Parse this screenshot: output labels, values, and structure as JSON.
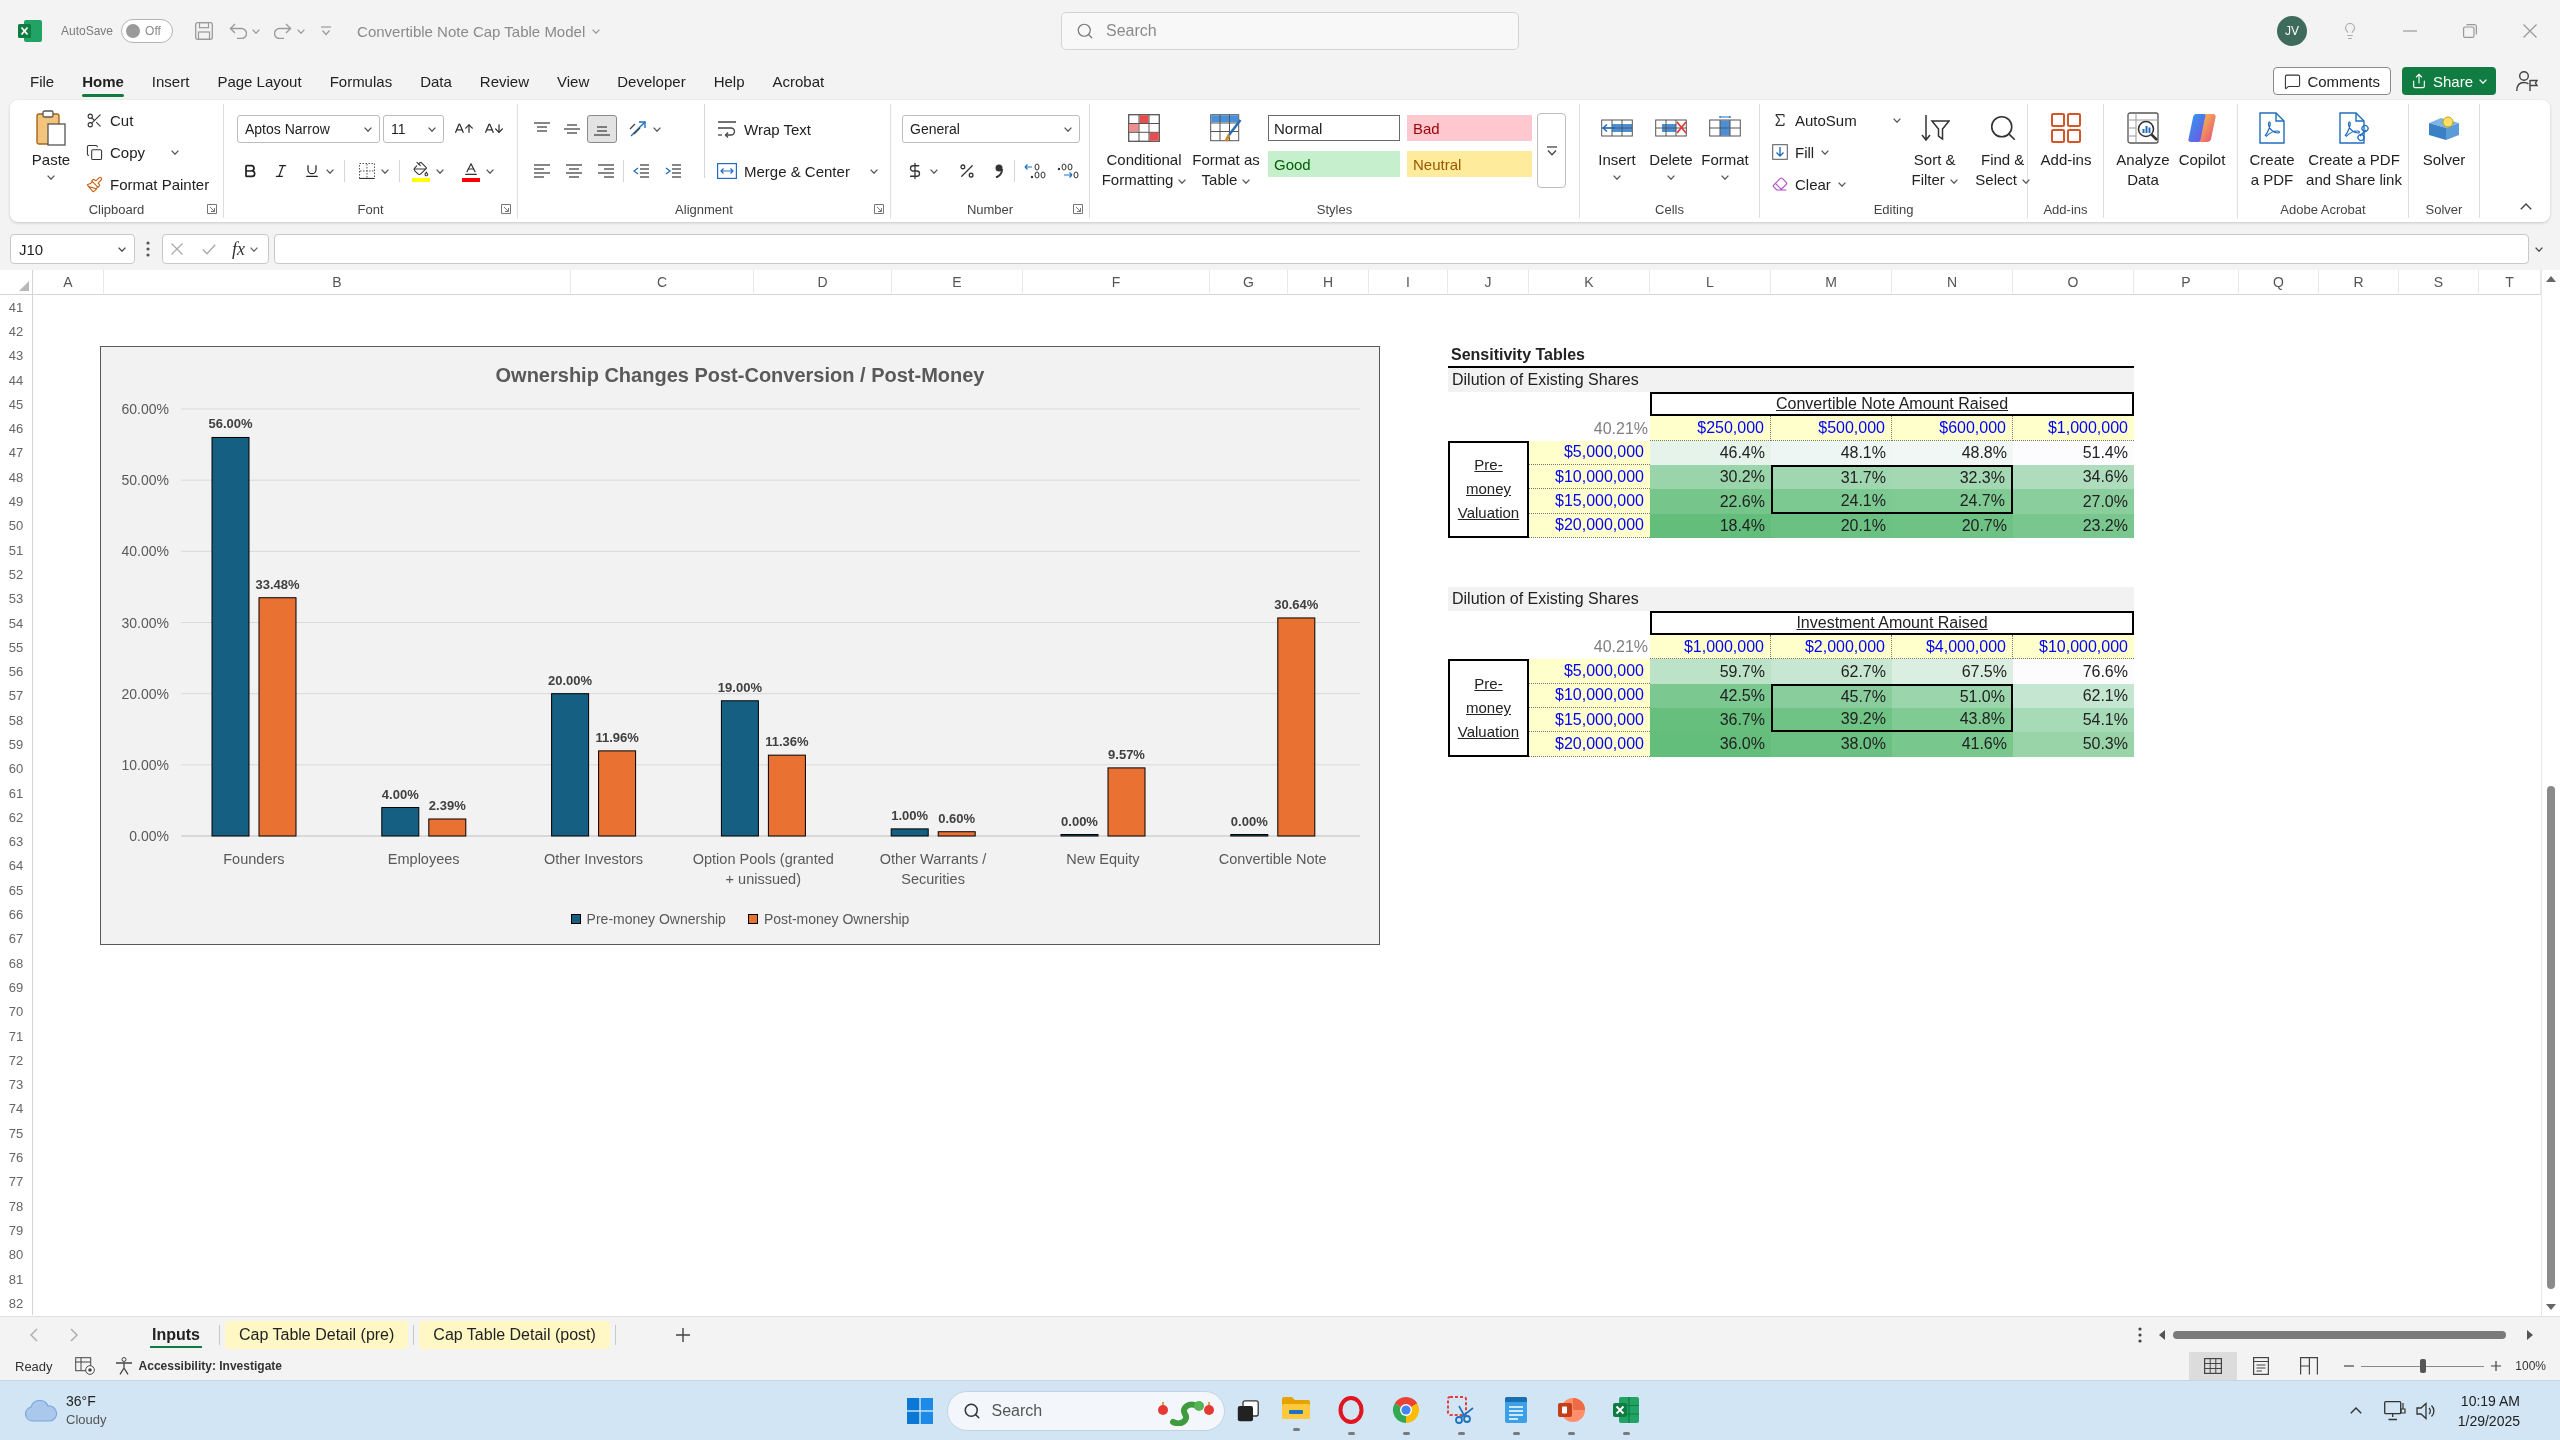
{
  "title_bar": {
    "autosave": {
      "label": "AutoSave",
      "toggle": "Off",
      "on": false
    },
    "document_title": "Convertible Note Cap Table Model",
    "search": {
      "placeholder": "Search"
    },
    "avatar": "JV"
  },
  "menu_tabs": [
    {
      "label": "File",
      "selected": false
    },
    {
      "label": "Home",
      "selected": true
    },
    {
      "label": "Insert",
      "selected": false
    },
    {
      "label": "Page Layout",
      "selected": false
    },
    {
      "label": "Formulas",
      "selected": false
    },
    {
      "label": "Data",
      "selected": false
    },
    {
      "label": "Review",
      "selected": false
    },
    {
      "label": "View",
      "selected": false
    },
    {
      "label": "Developer",
      "selected": false
    },
    {
      "label": "Help",
      "selected": false
    },
    {
      "label": "Acrobat",
      "selected": false
    }
  ],
  "header_actions": {
    "comments": "Comments",
    "share": "Share"
  },
  "ribbon": [
    {
      "kind": "clipboard",
      "label": "Clipboard",
      "launcher": true,
      "paste": "Paste",
      "commands": [
        "Cut",
        "Copy",
        "Format Painter"
      ]
    },
    {
      "kind": "font",
      "label": "Font",
      "launcher": true,
      "font_name": "Aptos Narrow",
      "font_size": "11"
    },
    {
      "kind": "alignment",
      "label": "Alignment",
      "launcher": true,
      "vertical_alignment": [
        {
          "selected": false
        },
        {
          "selected": false
        },
        {
          "selected": true
        }
      ],
      "wrap_text": "Wrap Text",
      "merge": "Merge & Center"
    },
    {
      "kind": "number",
      "label": "Number",
      "launcher": true,
      "format": "General"
    },
    {
      "kind": "styles",
      "label": "Styles",
      "commands": [
        "Conditional Formatting",
        "Format as Table"
      ],
      "cell_styles": [
        {
          "label": "Normal",
          "color": "#ffffff",
          "selected": true
        },
        {
          "label": "Bad",
          "color": "#ffc7ce",
          "selected": false
        },
        {
          "label": "Good",
          "color": "#c6efce",
          "selected": false
        },
        {
          "label": "Neutral",
          "color": "#ffeb9c",
          "selected": false
        }
      ]
    },
    {
      "kind": "cells",
      "label": "Cells",
      "commands": [
        "Insert",
        "Delete",
        "Format"
      ]
    },
    {
      "kind": "editing",
      "label": "Editing",
      "commands": [
        "AutoSum",
        "Fill",
        "Clear"
      ],
      "large_commands": [
        "Sort & Filter",
        "Find & Select"
      ]
    },
    {
      "kind": "addins",
      "label": "Add-ins",
      "commands": [
        "Add-ins"
      ]
    },
    {
      "kind": "analysis",
      "commands": [
        "Analyze Data",
        "Copilot"
      ]
    },
    {
      "kind": "acrobat",
      "label": "Adobe Acrobat",
      "commands": [
        "Create a PDF",
        "Create a PDF and Share link"
      ]
    },
    {
      "kind": "solver",
      "label": "Solver",
      "commands": [
        "Solver"
      ]
    }
  ],
  "formula_bar": {
    "name_box": "J10",
    "function_label": "fx"
  },
  "sheet": {
    "columns": [
      "A",
      "B",
      "C",
      "D",
      "E",
      "F",
      "G",
      "H",
      "I",
      "J",
      "K",
      "L",
      "M",
      "N",
      "O",
      "P",
      "Q",
      "R",
      "S",
      "T"
    ],
    "rows": [
      "41",
      "42",
      "43",
      "44",
      "45",
      "46",
      "47",
      "48",
      "49",
      "50",
      "51",
      "52",
      "53",
      "54",
      "55",
      "56",
      "57",
      "58",
      "59",
      "60",
      "61",
      "62",
      "63",
      "64",
      "65",
      "66",
      "67",
      "68",
      "69",
      "70",
      "71",
      "72",
      "73",
      "74",
      "75",
      "76",
      "77",
      "78",
      "79",
      "80",
      "81",
      "82"
    ]
  },
  "chart": {
    "chart_data": {
      "type": "bar",
      "title": "Ownership Changes Post-Conversion / Post-Money",
      "categories": [
        "Founders",
        "Employees",
        "Other Investors",
        "Option Pools (granted + unissued)",
        "Other Warrants / Securities",
        "New Equity",
        "Convertible Note"
      ],
      "series": [
        {
          "name": "Pre-money Ownership",
          "color": "#156082",
          "values": [
            56,
            4,
            20,
            19,
            1,
            0,
            0
          ],
          "value_labels": [
            "56.00%",
            "4.00%",
            "20.00%",
            "19.00%",
            "1.00%",
            "0.00%",
            "0.00%"
          ]
        },
        {
          "name": "Post-money Ownership",
          "color": "#e97132",
          "values": [
            33.48,
            2.39,
            11.96,
            11.36,
            0.6,
            9.57,
            30.64
          ],
          "value_labels": [
            "33.48%",
            "2.39%",
            "11.96%",
            "11.36%",
            "0.60%",
            "9.57%",
            "30.64%"
          ]
        }
      ],
      "ylim": [
        0,
        60
      ],
      "yticks": [
        {
          "value": 0,
          "label": "0.00%"
        },
        {
          "value": 10,
          "label": "10.00%"
        },
        {
          "value": 20,
          "label": "20.00%"
        },
        {
          "value": 30,
          "label": "30.00%"
        },
        {
          "value": 40,
          "label": "40.00%"
        },
        {
          "value": 50,
          "label": "50.00%"
        },
        {
          "value": 60,
          "label": "60.00%"
        }
      ],
      "grid": true,
      "legend": "bottom"
    }
  },
  "sensitivity": {
    "title": "Sensitivity Tables",
    "tables": [
      {
        "title": "Dilution of Existing Shares",
        "column_header": "Convertible Note Amount Raised",
        "corner": "40.21%",
        "columns": [
          "$250,000",
          "$500,000",
          "$600,000",
          "$1,000,000"
        ],
        "row_header": "Pre-money Valuation",
        "rows": [
          {
            "label": "$5,000,000",
            "cells": [
              {
                "value": "46.4%",
                "color": "#e5f3eb",
                "outlined": false
              },
              {
                "value": "48.1%",
                "color": "#edf6f2",
                "outlined": false
              },
              {
                "value": "48.8%",
                "color": "#f0f7f5",
                "outlined": false
              },
              {
                "value": "51.4%",
                "color": "#fcfcff",
                "outlined": false
              }
            ]
          },
          {
            "label": "$10,000,000",
            "cells": [
              {
                "value": "30.2%",
                "color": "#9ad4aa",
                "outlined": false
              },
              {
                "value": "31.7%",
                "color": "#a1d7b0",
                "outlined": true
              },
              {
                "value": "32.3%",
                "color": "#a3d8b3",
                "outlined": true
              },
              {
                "value": "34.6%",
                "color": "#aedcbc",
                "outlined": false
              }
            ]
          },
          {
            "label": "$15,000,000",
            "cells": [
              {
                "value": "22.6%",
                "color": "#76c68c",
                "outlined": false
              },
              {
                "value": "24.1%",
                "color": "#7dc992",
                "outlined": true
              },
              {
                "value": "24.7%",
                "color": "#80ca94",
                "outlined": true
              },
              {
                "value": "27.0%",
                "color": "#8bce9d",
                "outlined": false
              }
            ]
          },
          {
            "label": "$20,000,000",
            "cells": [
              {
                "value": "18.4%",
                "color": "#63be7b",
                "outlined": false
              },
              {
                "value": "20.1%",
                "color": "#6bc182",
                "outlined": false
              },
              {
                "value": "20.7%",
                "color": "#6ec284",
                "outlined": false
              },
              {
                "value": "23.2%",
                "color": "#79c78e",
                "outlined": false
              }
            ]
          }
        ]
      },
      {
        "title": "Dilution of Existing Shares",
        "column_header": "Investment Amount Raised",
        "corner": "40.21%",
        "columns": [
          "$1,000,000",
          "$2,000,000",
          "$4,000,000",
          "$10,000,000"
        ],
        "row_header": "Pre-money Valuation",
        "rows": [
          {
            "label": "$5,000,000",
            "cells": [
              {
                "value": "59.7%",
                "color": "#bce2c8",
                "outlined": false
              },
              {
                "value": "62.7%",
                "color": "#c8e7d2",
                "outlined": false
              },
              {
                "value": "67.5%",
                "color": "#daeee1",
                "outlined": false
              },
              {
                "value": "76.6%",
                "color": "#fcfcff",
                "outlined": false
              }
            ]
          },
          {
            "label": "$10,000,000",
            "cells": [
              {
                "value": "42.5%",
                "color": "#7bc890",
                "outlined": false
              },
              {
                "value": "45.7%",
                "color": "#88cd9b",
                "outlined": true
              },
              {
                "value": "51.0%",
                "color": "#9bd5ac",
                "outlined": true
              },
              {
                "value": "62.1%",
                "color": "#c5e6d0",
                "outlined": false
              }
            ]
          },
          {
            "label": "$15,000,000",
            "cells": [
              {
                "value": "36.7%",
                "color": "#66bf7d",
                "outlined": false
              },
              {
                "value": "39.2%",
                "color": "#6fc385",
                "outlined": true
              },
              {
                "value": "43.8%",
                "color": "#80ca94",
                "outlined": true
              },
              {
                "value": "54.1%",
                "color": "#a7dab6",
                "outlined": false
              }
            ]
          },
          {
            "label": "$20,000,000",
            "cells": [
              {
                "value": "36.0%",
                "color": "#63be7b",
                "outlined": false
              },
              {
                "value": "38.0%",
                "color": "#6bc181",
                "outlined": false
              },
              {
                "value": "41.6%",
                "color": "#78c78d",
                "outlined": false
              },
              {
                "value": "50.3%",
                "color": "#99d4a9",
                "outlined": false
              }
            ]
          }
        ]
      }
    ]
  },
  "sheet_tabs": [
    {
      "label": "Inputs",
      "selected": true
    },
    {
      "label": "Cap Table Detail (pre)",
      "selected": false,
      "color": "#fff8c5"
    },
    {
      "label": "Cap Table Detail (post)",
      "selected": false,
      "color": "#fff8c5"
    }
  ],
  "status_bar": {
    "mode": "Ready",
    "accessibility": "Accessibility: Investigate",
    "views": [
      {
        "selected": true
      },
      {
        "selected": false
      },
      {
        "selected": false
      }
    ],
    "zoom": {
      "level": 0.5,
      "reading": "100%"
    }
  },
  "taskbar": {
    "weather": {
      "temperature": "36°F",
      "condition": "Cloudy"
    },
    "search": {
      "placeholder": "Search"
    },
    "apps": [
      {
        "running": true
      },
      {
        "running": true
      },
      {
        "running": true
      },
      {
        "running": true
      },
      {
        "running": true
      },
      {
        "running": true
      },
      {
        "running": true
      }
    ],
    "clock": {
      "time": "10:19 AM",
      "date": "1/29/2025"
    }
  }
}
